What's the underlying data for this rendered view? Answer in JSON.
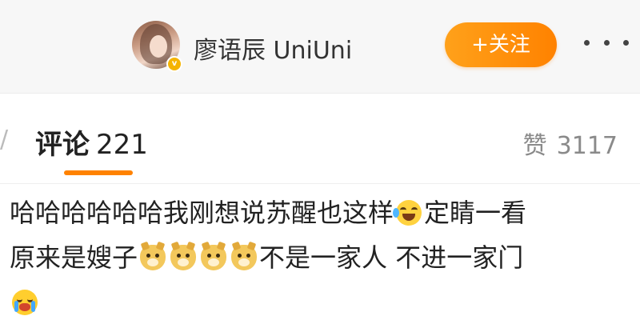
{
  "header": {
    "username": "廖语辰 UniUni",
    "follow_label": "+关注",
    "avatar_icon": "user-avatar",
    "verified_icon": "verified-badge-icon",
    "verified_glyph": "v",
    "more_icon": "more-dots-icon"
  },
  "tabs": {
    "edge_text": "/",
    "comments_label": "评论",
    "comments_count": "221",
    "likes_label": "赞",
    "likes_count": "3117",
    "accent_color": "#ff8200"
  },
  "comment": {
    "line1_text_a": "哈哈哈哈哈哈我刚想说苏醒也这样",
    "line1_emoji": "laugh-cry-emoji",
    "line1_text_b": "定睛一看",
    "line2_text_a": "原来是嫂子",
    "line2_emojis": [
      "doge-emoji",
      "doge-emoji",
      "doge-emoji",
      "doge-emoji"
    ],
    "line2_text_b": "不是一家人 不进一家门",
    "line3_emoji": "crying-emoji"
  }
}
